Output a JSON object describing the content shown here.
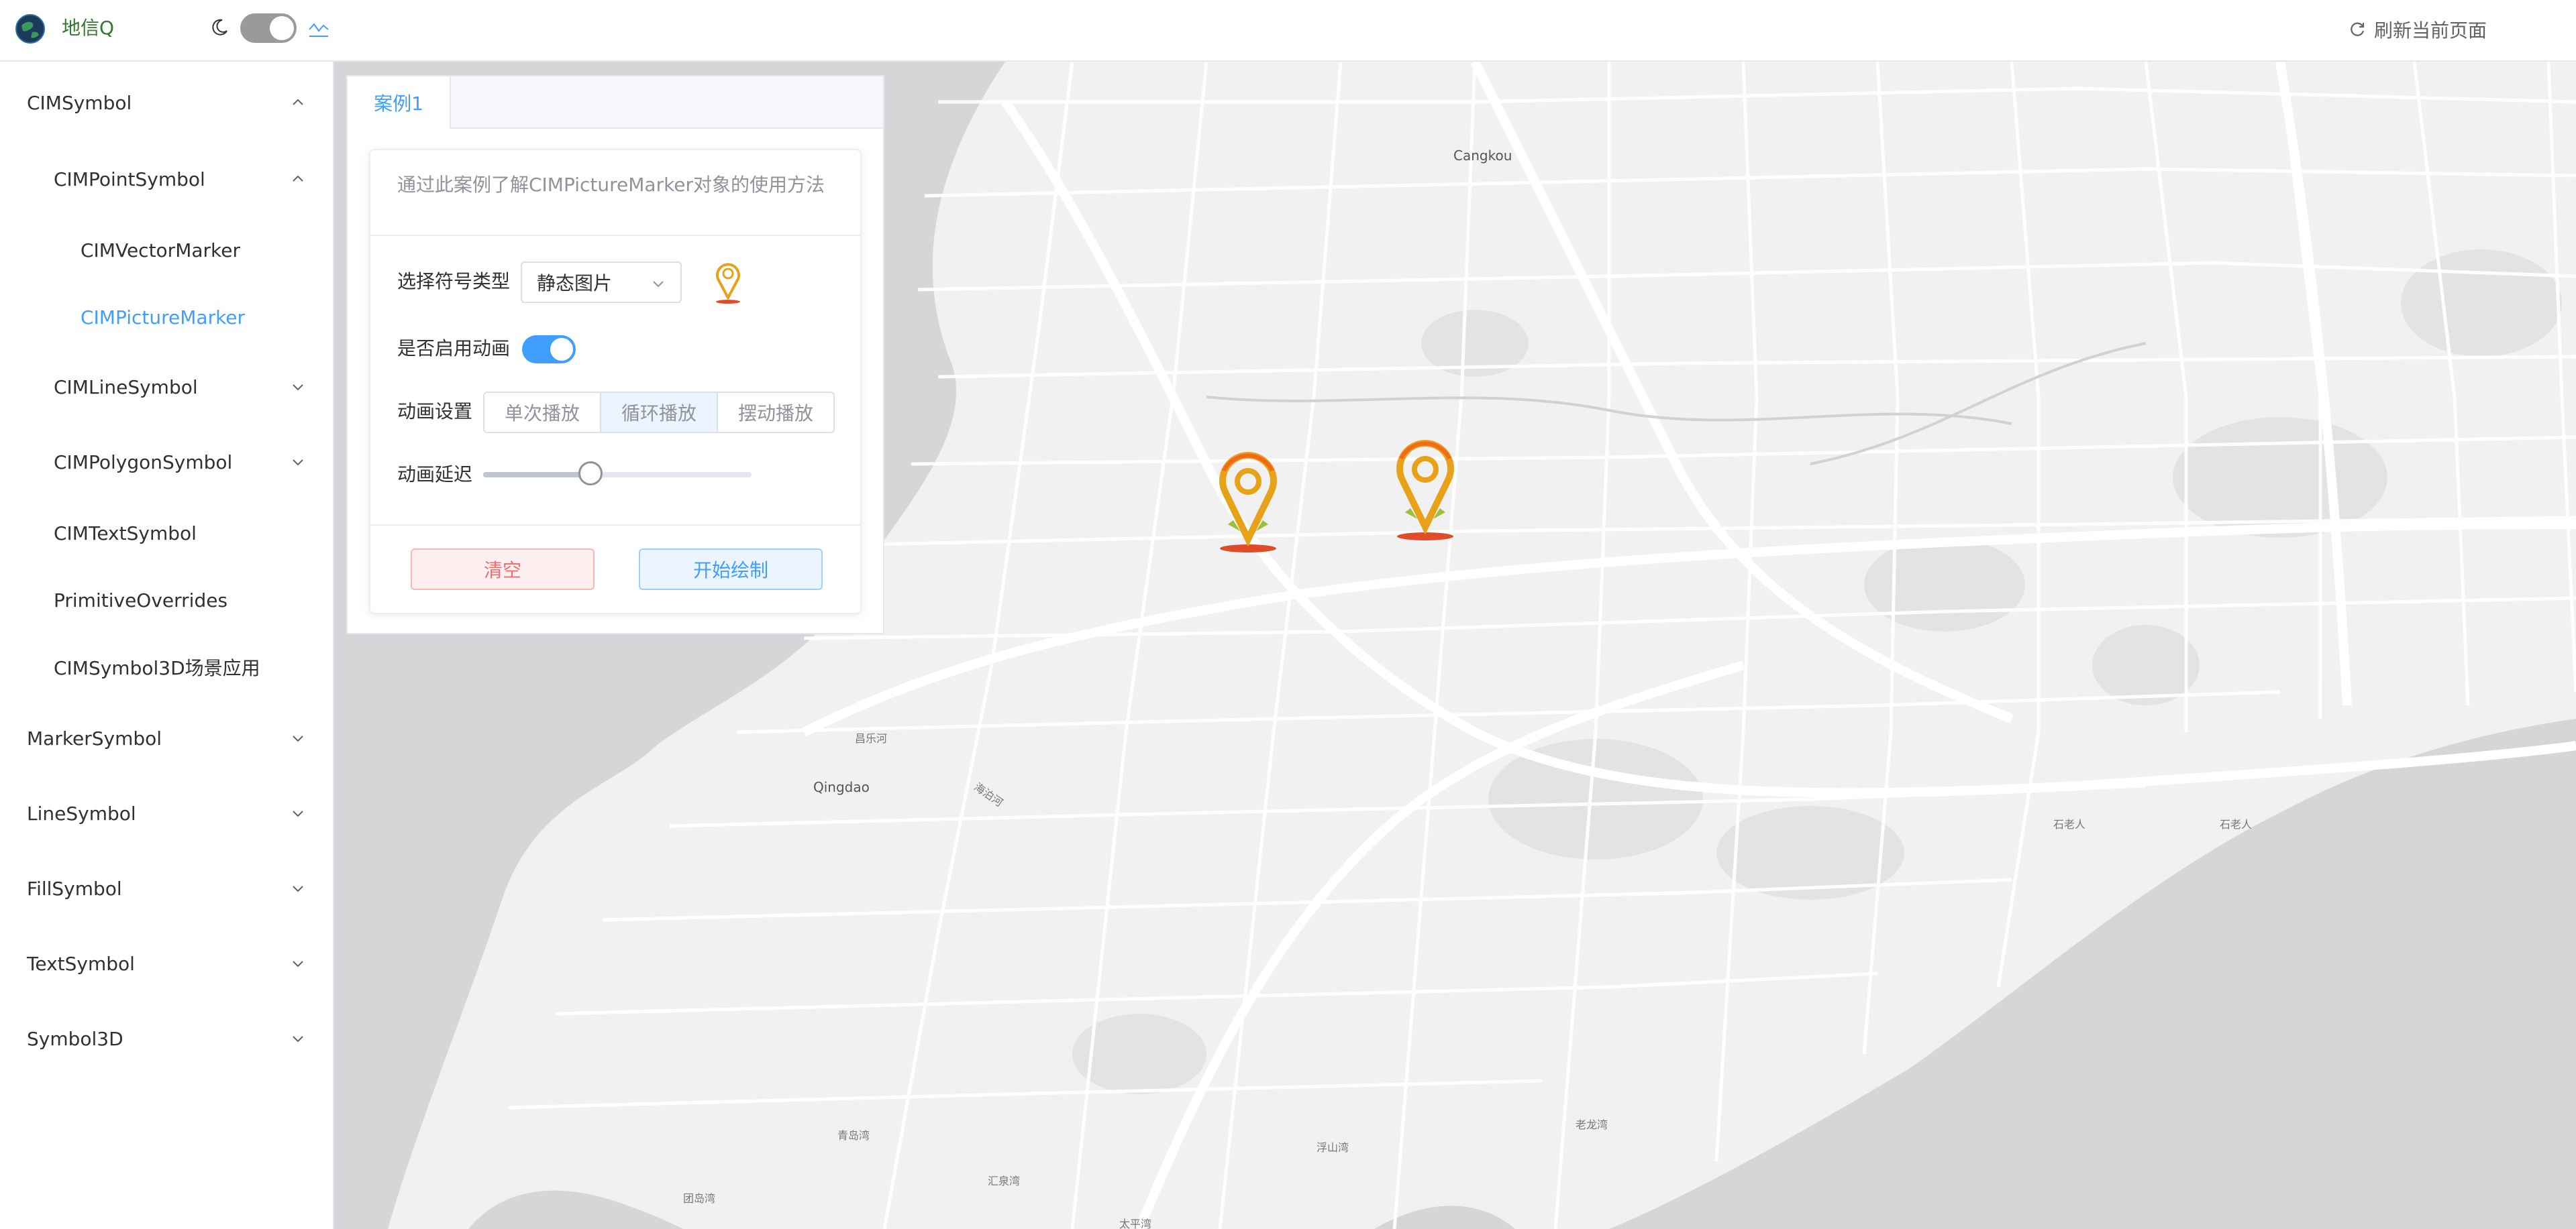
{
  "header": {
    "app_title": "地信Q",
    "refresh_label": "刷新当前页面",
    "accent": "#409eff"
  },
  "sidebar": {
    "items": [
      {
        "label": "CIMSymbol",
        "level": 1,
        "icon": "chevron-up-icon"
      },
      {
        "label": "CIMPointSymbol",
        "level": 2,
        "icon": "chevron-up-icon"
      },
      {
        "label": "CIMVectorMarker",
        "level": 3
      },
      {
        "label": "CIMPictureMarker",
        "level": 3,
        "active": true
      },
      {
        "label": "CIMLineSymbol",
        "level": 2,
        "icon": "chevron-down-icon"
      },
      {
        "label": "CIMPolygonSymbol",
        "level": 2,
        "icon": "chevron-down-icon"
      },
      {
        "label": "CIMTextSymbol",
        "level": 2
      },
      {
        "label": "PrimitiveOverrides",
        "level": 2
      },
      {
        "label": "CIMSymbol3D场景应用",
        "level": 2
      },
      {
        "label": "MarkerSymbol",
        "level": 1,
        "icon": "chevron-down-icon"
      },
      {
        "label": "LineSymbol",
        "level": 1,
        "icon": "chevron-down-icon"
      },
      {
        "label": "FillSymbol",
        "level": 1,
        "icon": "chevron-down-icon"
      },
      {
        "label": "TextSymbol",
        "level": 1,
        "icon": "chevron-down-icon"
      },
      {
        "label": "Symbol3D",
        "level": 1,
        "icon": "chevron-down-icon"
      }
    ]
  },
  "panel": {
    "tab_label": "案例1",
    "description": "通过此案例了解CIMPictureMarker对象的使用方法",
    "symbol_type_label": "选择符号类型",
    "symbol_type_value": "静态图片",
    "animation_enabled_label": "是否启用动画",
    "animation_enabled": true,
    "animation_setting_label": "动画设置",
    "animation_options": [
      "单次播放",
      "循环播放",
      "摆动播放"
    ],
    "animation_selected": "循环播放",
    "animation_delay_label": "动画延迟",
    "animation_delay": 0.4,
    "clear_label": "清空",
    "start_label": "开始绘制"
  },
  "map": {
    "labels": [
      "Cangkou",
      "Qingdao",
      "昌乐河",
      "海泊河",
      "石老人",
      "石老人",
      "青岛湾",
      "汇泉湾",
      "浮山湾",
      "老龙湾",
      "团岛湾",
      "太平湾"
    ]
  }
}
